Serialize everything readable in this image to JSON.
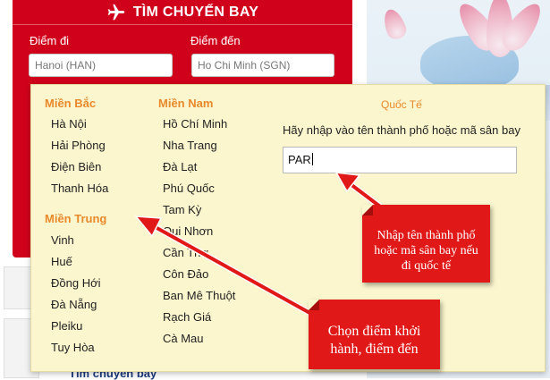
{
  "header": {
    "title": "TÌM CHUYẾN BAY",
    "from_label": "Điểm đi",
    "to_label": "Điểm đến",
    "from_value": "Hanoi (HAN)",
    "to_value": "Ho Chi Minh (SGN)"
  },
  "dropdown": {
    "north": {
      "heading": "Miền Bắc",
      "cities": [
        "Hà Nội",
        "Hải Phòng",
        "Điện Biên",
        "Thanh Hóa"
      ]
    },
    "central": {
      "heading": "Miền Trung",
      "cities": [
        "Vinh",
        "Huế",
        "Đồng Hới",
        "Đà Nẵng",
        "Pleiku",
        "Tuy Hòa"
      ]
    },
    "south": {
      "heading": "Miền Nam",
      "cities": [
        "Hồ Chí Minh",
        "Nha Trang",
        "Đà Lạt",
        "Phú Quốc",
        "Tam Kỳ",
        "Qui Nhơn",
        "Cần Thơ",
        "Côn Đảo",
        "Ban Mê Thuột",
        "Rạch Giá",
        "Cà Mau"
      ]
    },
    "international": {
      "title": "Quốc Tế",
      "hint": "Hãy nhập vào tên thành phố hoặc mã sân bay",
      "input_value": "PAR"
    }
  },
  "callouts": {
    "intl": "Nhập tên thành phố hoặc mã sân bay nếu đi quốc tế",
    "domestic": "Chọn điểm khởi hành, điểm đến"
  },
  "background": {
    "bottom_text": "Tìm chuyến bay"
  },
  "colors": {
    "brand_red": "#d0021b",
    "dropdown_bg": "#fbf6cd",
    "heading_orange": "#e8892c",
    "callout_red": "#e01818"
  }
}
